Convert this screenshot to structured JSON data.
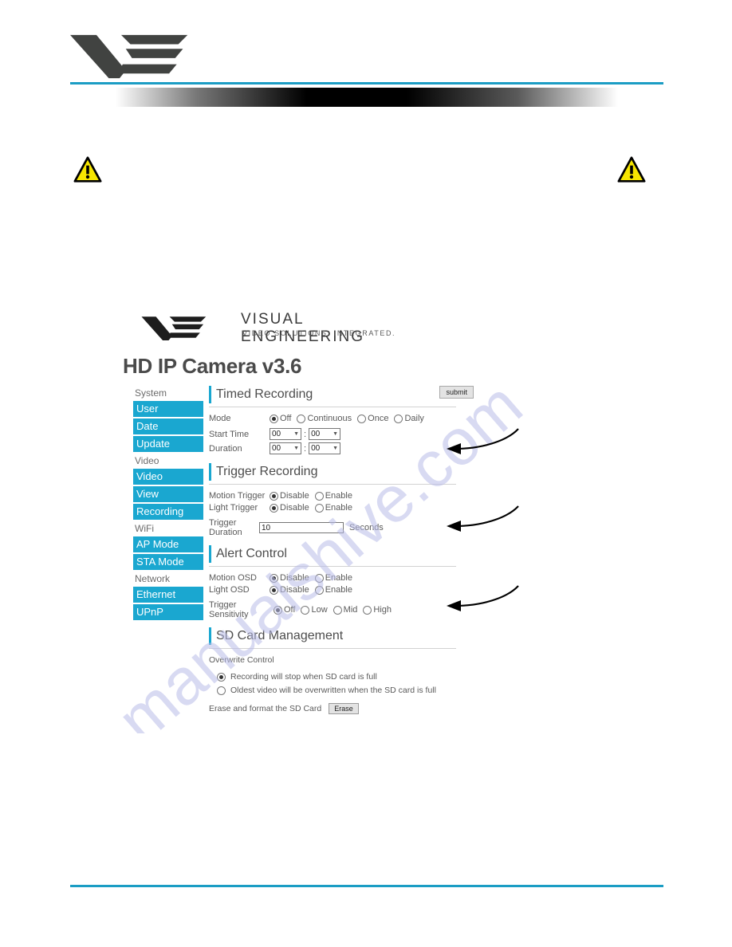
{
  "document": {
    "header_logo": "ve-logo",
    "warning_icon_left": "warning-triangle-icon",
    "warning_icon_right": "warning-triangle-icon"
  },
  "app": {
    "brand_name": "VISUAL ENGINEERING",
    "brand_tagline": "VIDEO SOLUTIONS. INTEGRATED.",
    "title": "HD IP Camera v3.6",
    "accent_color": "#1aa7d0",
    "sidebar": {
      "groups": [
        {
          "label": "System",
          "items": [
            "User",
            "Date",
            "Update"
          ]
        },
        {
          "label": "Video",
          "items": [
            "Video",
            "View",
            "Recording"
          ]
        },
        {
          "label": "WiFi",
          "items": [
            "AP Mode",
            "STA Mode"
          ]
        },
        {
          "label": "Network",
          "items": [
            "Ethernet",
            "UPnP"
          ]
        }
      ]
    },
    "timed_recording": {
      "heading": "Timed Recording",
      "submit_label": "submit",
      "mode_label": "Mode",
      "mode_options": [
        "Off",
        "Continuous",
        "Once",
        "Daily"
      ],
      "mode_selected": "Off",
      "start_time_label": "Start Time",
      "start_time_hours": "00",
      "start_time_minutes": "00",
      "duration_label": "Duration",
      "duration_hours": "00",
      "duration_minutes": "00"
    },
    "trigger_recording": {
      "heading": "Trigger Recording",
      "motion_trigger_label": "Motion Trigger",
      "motion_trigger_options": [
        "Disable",
        "Enable"
      ],
      "motion_trigger_selected": "Disable",
      "light_trigger_label": "Light Trigger",
      "light_trigger_options": [
        "Disable",
        "Enable"
      ],
      "light_trigger_selected": "Disable",
      "trigger_duration_label": "Trigger Duration",
      "trigger_duration_value": "10",
      "trigger_duration_unit": "Seconds"
    },
    "alert_control": {
      "heading": "Alert Control",
      "motion_osd_label": "Motion OSD",
      "motion_osd_options": [
        "Disable",
        "Enable"
      ],
      "motion_osd_selected": "Disable",
      "light_osd_label": "Light OSD",
      "light_osd_options": [
        "Disable",
        "Enable"
      ],
      "light_osd_selected": "Disable",
      "sensitivity_label": "Trigger Sensitivity",
      "sensitivity_options": [
        "Off",
        "Low",
        "Mid",
        "High"
      ],
      "sensitivity_selected": "Off"
    },
    "sd_card": {
      "heading": "SD Card Management",
      "overwrite_label": "Overwrite Control",
      "option_stop": "Recording will stop when SD card is full",
      "option_overwrite": "Oldest video will be overwritten when the SD card is full",
      "selected": "Recording will stop when SD card is full",
      "erase_label": "Erase and format the SD Card",
      "erase_button": "Erase"
    }
  },
  "watermark": {
    "text": "manualshive.com"
  }
}
